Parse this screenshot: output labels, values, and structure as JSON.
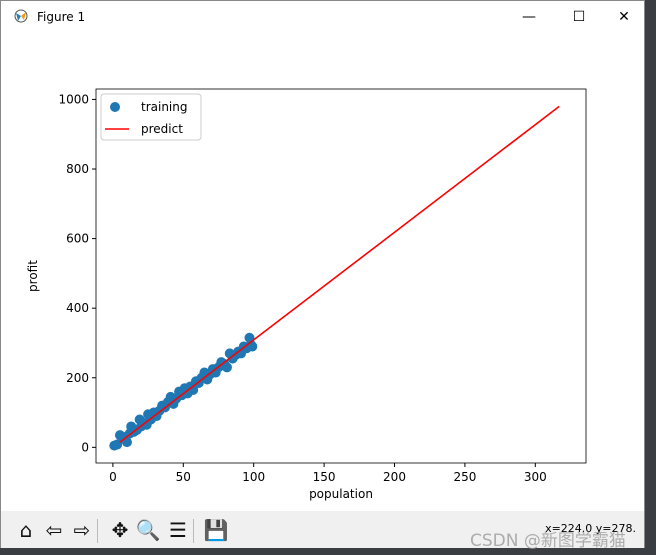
{
  "window": {
    "title": "Figure 1",
    "minimize": "—",
    "maximize": "☐",
    "close": "✕"
  },
  "toolbar": {
    "items": [
      {
        "name": "home-icon",
        "glyph": "⌂"
      },
      {
        "name": "back-icon",
        "glyph": "⇦"
      },
      {
        "name": "forward-icon",
        "glyph": "⇨"
      },
      {
        "name": "pan-icon",
        "glyph": "✥"
      },
      {
        "name": "zoom-icon",
        "glyph": "🔍"
      },
      {
        "name": "configure-subplots-icon",
        "glyph": "☰"
      },
      {
        "name": "save-icon",
        "glyph": "💾"
      }
    ],
    "coords": "x=224.0 y=278."
  },
  "watermark": "CSDN @新图学霸猫",
  "chart_data": {
    "type": "scatter",
    "xlabel": "population",
    "ylabel": "profit",
    "xlim": [
      -12,
      336
    ],
    "ylim": [
      -45,
      1030
    ],
    "xticks": [
      0,
      50,
      100,
      150,
      200,
      250,
      300
    ],
    "yticks": [
      0,
      200,
      400,
      600,
      800,
      1000
    ],
    "legend": {
      "placement": "upper-left",
      "entries": [
        "training",
        "predict"
      ]
    },
    "colors": {
      "training": "#1f77b4",
      "predict": "#ff0000"
    },
    "series": [
      {
        "name": "training",
        "type": "scatter",
        "points": [
          [
            1,
            5
          ],
          [
            3,
            8
          ],
          [
            5,
            35
          ],
          [
            7,
            25
          ],
          [
            9,
            30
          ],
          [
            10,
            15
          ],
          [
            12,
            40
          ],
          [
            13,
            60
          ],
          [
            15,
            45
          ],
          [
            17,
            50
          ],
          [
            19,
            80
          ],
          [
            20,
            60
          ],
          [
            22,
            70
          ],
          [
            24,
            65
          ],
          [
            25,
            95
          ],
          [
            27,
            80
          ],
          [
            29,
            100
          ],
          [
            31,
            90
          ],
          [
            33,
            105
          ],
          [
            35,
            120
          ],
          [
            37,
            115
          ],
          [
            39,
            130
          ],
          [
            41,
            145
          ],
          [
            43,
            125
          ],
          [
            45,
            140
          ],
          [
            47,
            160
          ],
          [
            49,
            150
          ],
          [
            51,
            170
          ],
          [
            53,
            155
          ],
          [
            55,
            175
          ],
          [
            57,
            165
          ],
          [
            59,
            190
          ],
          [
            61,
            185
          ],
          [
            63,
            200
          ],
          [
            65,
            215
          ],
          [
            67,
            195
          ],
          [
            69,
            210
          ],
          [
            71,
            225
          ],
          [
            73,
            215
          ],
          [
            75,
            230
          ],
          [
            77,
            245
          ],
          [
            79,
            240
          ],
          [
            81,
            230
          ],
          [
            83,
            270
          ],
          [
            85,
            255
          ],
          [
            87,
            265
          ],
          [
            89,
            275
          ],
          [
            91,
            270
          ],
          [
            93,
            290
          ],
          [
            95,
            285
          ],
          [
            97,
            315
          ],
          [
            98,
            295
          ],
          [
            99,
            290
          ]
        ]
      },
      {
        "name": "predict",
        "type": "line",
        "points": [
          [
            5,
            15
          ],
          [
            317,
            980
          ]
        ]
      }
    ]
  }
}
